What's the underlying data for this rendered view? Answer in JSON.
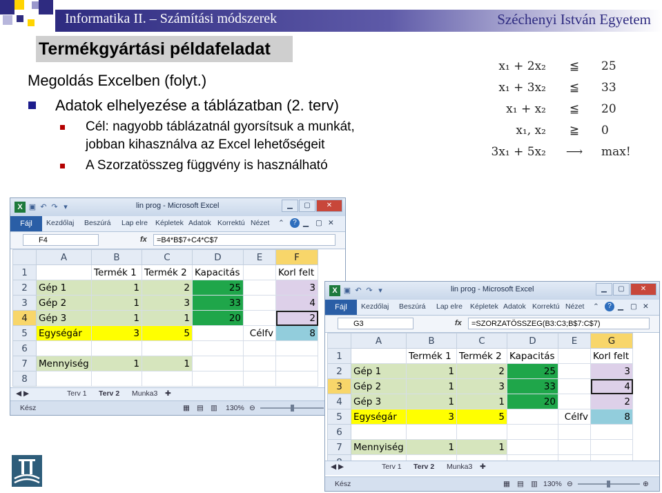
{
  "header": {
    "course": "Informatika II. – Számítási módszerek",
    "university": "Széchenyi István Egyetem",
    "title": "Termékgyártási példafeladat"
  },
  "content": {
    "section": "Megoldás Excelben (folyt.)",
    "bullet": "Adatok elhelyezése a táblázatban (2. terv)",
    "sub1_line1": "Cél: nagyobb táblázatnál gyorsítsuk a munkát,",
    "sub1_line2": "jobban kihasználva az Excel lehetőségeit",
    "sub2": "A Szorzatösszeg függvény is használható"
  },
  "formula": {
    "rows": [
      {
        "lhs": "x₁ + 2x₂",
        "op": "≦",
        "rhs": "25"
      },
      {
        "lhs": "x₁ + 3x₂",
        "op": "≦",
        "rhs": "33"
      },
      {
        "lhs": "x₁ +  x₂",
        "op": "≦",
        "rhs": "20"
      },
      {
        "lhs": "x₁, x₂",
        "op": "≧",
        "rhs": "0"
      },
      {
        "lhs": "3x₁ + 5x₂",
        "op": "⟶",
        "rhs": "max!"
      }
    ]
  },
  "excel1": {
    "caption": "lin prog - Microsoft Excel",
    "ribbon_tabs": [
      "Fájl",
      "Kezdőlaj",
      "Beszúrá",
      "Lap elre",
      "Képletek",
      "Adatok",
      "Korrektú",
      "Nézet"
    ],
    "name_box": "F4",
    "fx": "fx",
    "formula": "=B4*B$7+C4*C$7",
    "columns": [
      "A",
      "B",
      "C",
      "D",
      "E",
      "F"
    ],
    "rows": [
      {
        "n": "1",
        "A": "",
        "B": "Termék 1",
        "C": "Termék 2",
        "D": "Kapacitás",
        "E": "",
        "F": "Korl felt"
      },
      {
        "n": "2",
        "A": "Gép 1",
        "B": "1",
        "C": "2",
        "D": "25",
        "E": "",
        "F": "3"
      },
      {
        "n": "3",
        "A": "Gép 2",
        "B": "1",
        "C": "3",
        "D": "33",
        "E": "",
        "F": "4"
      },
      {
        "n": "4",
        "A": "Gép 3",
        "B": "1",
        "C": "1",
        "D": "20",
        "E": "",
        "F": "2"
      },
      {
        "n": "5",
        "A": "Egységár",
        "B": "3",
        "C": "5",
        "D": "",
        "E": "Célfv",
        "F": "8"
      },
      {
        "n": "6",
        "A": "",
        "B": "",
        "C": "",
        "D": "",
        "E": "",
        "F": ""
      },
      {
        "n": "7",
        "A": "Mennyiség",
        "B": "1",
        "C": "1",
        "D": "",
        "E": "",
        "F": ""
      },
      {
        "n": "8",
        "A": "",
        "B": "",
        "C": "",
        "D": "",
        "E": "",
        "F": ""
      }
    ],
    "sheet_tabs": [
      "Terv 1",
      "Terv 2",
      "Munka3"
    ],
    "active_tab": "Terv 2",
    "status": "Kész",
    "zoom": "130%"
  },
  "excel2": {
    "caption": "lin prog - Microsoft Excel",
    "ribbon_tabs": [
      "Fájl",
      "Kezdőlaj",
      "Beszúrá",
      "Lap elre",
      "Képletek",
      "Adatok",
      "Korrektú",
      "Nézet"
    ],
    "name_box": "G3",
    "fx": "fx",
    "formula": "=SZORZATÖSSZEG(B3:C3;B$7:C$7)",
    "columns": [
      "A",
      "B",
      "C",
      "D",
      "E",
      "G"
    ],
    "rows": [
      {
        "n": "1",
        "A": "",
        "B": "Termék 1",
        "C": "Termék 2",
        "D": "Kapacitás",
        "E": "",
        "F": "Korl felt"
      },
      {
        "n": "2",
        "A": "Gép 1",
        "B": "1",
        "C": "2",
        "D": "25",
        "E": "",
        "F": "3"
      },
      {
        "n": "3",
        "A": "Gép 2",
        "B": "1",
        "C": "3",
        "D": "33",
        "E": "",
        "F": "4"
      },
      {
        "n": "4",
        "A": "Gép 3",
        "B": "1",
        "C": "1",
        "D": "20",
        "E": "",
        "F": "2"
      },
      {
        "n": "5",
        "A": "Egységár",
        "B": "3",
        "C": "5",
        "D": "",
        "E": "Célfv",
        "F": "8"
      },
      {
        "n": "6",
        "A": "",
        "B": "",
        "C": "",
        "D": "",
        "E": "",
        "F": ""
      },
      {
        "n": "7",
        "A": "Mennyiség",
        "B": "1",
        "C": "1",
        "D": "",
        "E": "",
        "F": ""
      },
      {
        "n": "8",
        "A": "",
        "B": "",
        "C": "",
        "D": "",
        "E": "",
        "F": ""
      }
    ],
    "sheet_tabs": [
      "Terv 1",
      "Terv 2",
      "Munka3"
    ],
    "active_tab": "Terv 2",
    "status": "Kész",
    "zoom": "130%"
  },
  "colors": {
    "header_navy": "#2e2b80",
    "bullet_blue": "#1c1c8c",
    "bullet_red": "#b40000",
    "cell_light_green": "#d6e5bd",
    "cell_green": "#1fa64a",
    "cell_yellow": "#ffff00",
    "cell_purple": "#ddd0e9",
    "cell_blue": "#92cddc"
  }
}
